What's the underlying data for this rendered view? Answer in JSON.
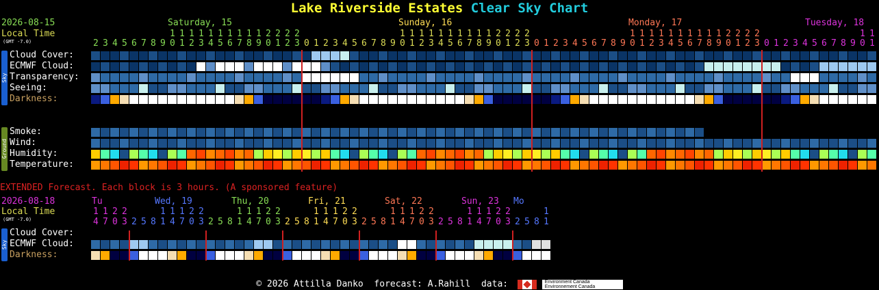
{
  "title": {
    "location": "Lake Riverside Estates",
    "chart": "Clear Sky Chart"
  },
  "header": {
    "date": "2026-08-15",
    "local_time": "Local Time",
    "gmt": "(GMT -7.0)",
    "days": [
      {
        "label": "Saturday, 15",
        "color": "#88dd55"
      },
      {
        "label": "Sunday, 16",
        "color": "#ffdd55"
      },
      {
        "label": "Monday, 17",
        "color": "#ff7755"
      },
      {
        "label": "Tuesday, 18",
        "color": "#dd33dd"
      }
    ],
    "hours": [
      2,
      3,
      4,
      5,
      6,
      7,
      8,
      9,
      10,
      11,
      12,
      13,
      14,
      15,
      16,
      17,
      18,
      19,
      20,
      21,
      22,
      23,
      0,
      1,
      2,
      3,
      4,
      5,
      6,
      7,
      8,
      9,
      10,
      11,
      12,
      13,
      14,
      15,
      16,
      17,
      18,
      19,
      20,
      21,
      22,
      23,
      0,
      1,
      2,
      3,
      4,
      5,
      6,
      7,
      8,
      9,
      10,
      11,
      12,
      13,
      14,
      15,
      16,
      17,
      18,
      19,
      20,
      21,
      22,
      23,
      0,
      1,
      2,
      3,
      4,
      5,
      6,
      7,
      8,
      9,
      10,
      11
    ]
  },
  "sky_label": "Sky",
  "ground_label": "Ground",
  "rows": {
    "cloud_cover": "Cloud Cover:",
    "ecmwf_cloud": "ECMWF Cloud:",
    "transparency": "Transparency:",
    "seeing": "Seeing:",
    "darkness": "Darkness:",
    "smoke": "Smoke:",
    "wind": "Wind:",
    "humidity": "Humidity:",
    "temperature": "Temperature:"
  },
  "palette": {
    "cloud": [
      "#0a3466",
      "#1b4e86",
      "#2e6aa6",
      "#5f8fc8",
      "#9ec9f0",
      "#c8f0ee",
      "#ffffff",
      "#e0e0e0"
    ],
    "humidity": [
      "#ff8800",
      "#ff6600",
      "#ff4400",
      "#ffcc00",
      "#ffee22",
      "#aaff55",
      "#55ffaa",
      "#22ddee",
      "#1b4e86",
      "#0a3466",
      "#201080"
    ],
    "temperature": [
      "#ff9900",
      "#ff7700",
      "#ff5500",
      "#ee2200",
      "#ff3300"
    ],
    "darkness": [
      "#000040",
      "#0a1a80",
      "#1c2fa0",
      "#3a60e0",
      "#ffaa00",
      "#f5deb3",
      "#ffffff"
    ]
  },
  "extended": {
    "notice": "EXTENDED Forecast. Each block is 3 hours. (A sponsored feature)",
    "date": "2026-08-18",
    "local_time": "Local Time",
    "gmt": "(GMT -7.0)",
    "days": [
      {
        "label": "Tu",
        "color": "#dd33dd"
      },
      {
        "label": "Wed, 19",
        "color": "#5577ff"
      },
      {
        "label": "Thu, 20",
        "color": "#88dd55"
      },
      {
        "label": "Fri, 21",
        "color": "#ffdd55"
      },
      {
        "label": "Sat, 22",
        "color": "#ff7755"
      },
      {
        "label": "Sun, 23",
        "color": "#dd33dd"
      },
      {
        "label": "Mo",
        "color": "#5577ff"
      }
    ],
    "hours": [
      14,
      17,
      20,
      23,
      2,
      5,
      8,
      11,
      14,
      17,
      20,
      23,
      2,
      5,
      8,
      11,
      14,
      17,
      20,
      23,
      2,
      5,
      8,
      11,
      14,
      17,
      20,
      23,
      2,
      5,
      8,
      11,
      14,
      17,
      20,
      23,
      2,
      5,
      8,
      11,
      14,
      17,
      20,
      23,
      2,
      5,
      8,
      11
    ],
    "rows": {
      "cloud_cover": "Cloud Cover:",
      "ecmwf_cloud": "ECMWF Cloud:",
      "darkness": "Darkness:"
    }
  },
  "footer": {
    "copyright": "© 2026 Attilla Danko",
    "forecast": "forecast: A.Rahill",
    "data": "data:",
    "env1": "Environment Canada",
    "env2": "Environnement Canada"
  }
}
